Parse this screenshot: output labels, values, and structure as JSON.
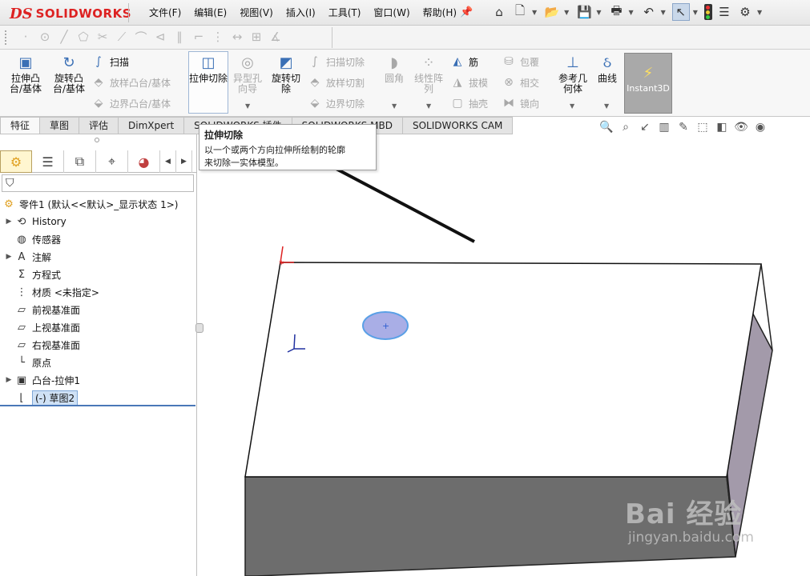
{
  "app": {
    "logo_ds": "DS",
    "logo_name": "SOLIDWORKS"
  },
  "menu": [
    "文件(F)",
    "编辑(E)",
    "视图(V)",
    "插入(I)",
    "工具(T)",
    "窗口(W)",
    "帮助(H)"
  ],
  "ribbon": {
    "extrude_boss": "拉伸凸台/基体",
    "revolve_boss": "旋转凸台/基体",
    "sweep": "扫描",
    "loft_boss": "放样凸台/基体",
    "boundary_boss": "边界凸台/基体",
    "extruded_cut": "拉伸切除",
    "hole_wizard": "异型孔向导",
    "revolved_cut": "旋转切除",
    "swept_cut": "扫描切除",
    "lofted_cut": "放样切割",
    "boundary_cut": "边界切除",
    "fillet": "圆角",
    "linear_pattern": "线性阵列",
    "rib": "筋",
    "draft": "拔模",
    "shell": "抽壳",
    "wrap": "包覆",
    "intersect": "相交",
    "mirror": "镜向",
    "ref_geometry": "参考几何体",
    "curves": "曲线",
    "instant3d": "Instant3D"
  },
  "tabs": [
    "特征",
    "草图",
    "评估",
    "DimXpert",
    "SOLIDWORKS 插件",
    "SOLIDWORKS MBD",
    "SOLIDWORKS CAM"
  ],
  "tooltip": {
    "title": "拉伸切除",
    "line1": "以一个或两个方向拉伸所绘制的轮廓",
    "line2": "来切除一实体模型。"
  },
  "tree": {
    "root": "零件1  (默认<<默认>_显示状态 1>)",
    "items": [
      {
        "label": "History",
        "expandable": true,
        "icon": "history-icon"
      },
      {
        "label": "传感器",
        "expandable": false,
        "icon": "sensor-icon"
      },
      {
        "label": "注解",
        "expandable": true,
        "icon": "annotation-icon"
      },
      {
        "label": "方程式",
        "expandable": false,
        "icon": "equation-icon"
      },
      {
        "label": "材质 <未指定>",
        "expandable": false,
        "icon": "material-icon"
      },
      {
        "label": "前视基准面",
        "expandable": false,
        "icon": "plane-icon"
      },
      {
        "label": "上视基准面",
        "expandable": false,
        "icon": "plane-icon"
      },
      {
        "label": "右视基准面",
        "expandable": false,
        "icon": "plane-icon"
      },
      {
        "label": "原点",
        "expandable": false,
        "icon": "origin-icon"
      },
      {
        "label": "凸台-拉伸1",
        "expandable": true,
        "icon": "extrude-icon"
      },
      {
        "label": "(-) 草图2",
        "expandable": false,
        "icon": "sketch-icon",
        "selected": true
      }
    ]
  },
  "watermark": {
    "brand": "Bai 经验",
    "url": "jingyan.baidu.com"
  },
  "colors": {
    "accent": "#4a78b8",
    "logo_red": "#dd2222",
    "selection": "#cfe1f5"
  }
}
